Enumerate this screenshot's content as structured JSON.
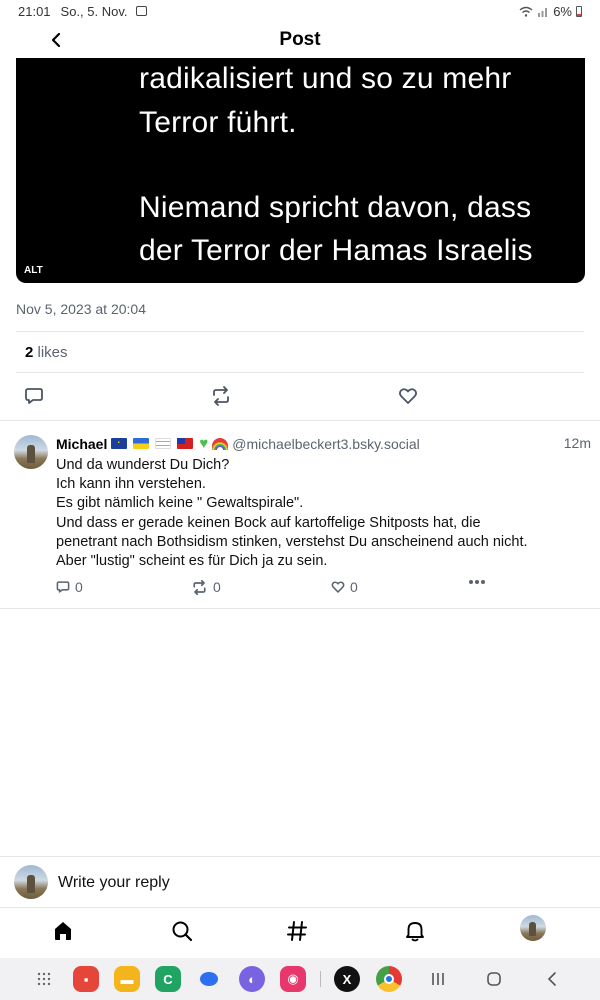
{
  "status_bar": {
    "time": "21:01",
    "date": "So., 5. Nov.",
    "battery": "6%"
  },
  "header": {
    "title": "Post"
  },
  "post": {
    "image_lines": [
      "radikalisiert und so zu mehr",
      "Terror führt.",
      "Niemand spricht davon, dass",
      "der Terror der Hamas Israelis"
    ],
    "alt_label": "ALT",
    "timestamp": "Nov 5, 2023 at 20:04",
    "likes_count": "2",
    "likes_label": "likes"
  },
  "reply": {
    "name": "Michael",
    "handle": "@michaelbeckert3.bsky.social",
    "time": "12m",
    "text_lines": [
      "Und da wunderst Du Dich?",
      "Ich kann ihn verstehen.",
      "Es gibt nämlich keine \" Gewaltspirale\".",
      "Und dass er gerade keinen Bock auf kartoffelige Shitposts hat, die",
      "penetrant nach Bothsidism stinken, verstehst Du anscheinend auch nicht.",
      "Aber \"lustig\" scheint es für Dich ja zu sein."
    ],
    "reply_count": "0",
    "repost_count": "0",
    "like_count": "0"
  },
  "composer": {
    "placeholder": "Write your reply"
  },
  "colors": {
    "muted_text": "#5b6470",
    "divider": "#e4e6e9",
    "image_bg": "#000000"
  },
  "icons": {
    "back": "chevron-left-icon",
    "reply": "speech-bubble-icon",
    "repost": "repost-arrows-icon",
    "like": "heart-icon",
    "more": "ellipsis-icon",
    "home": "home-icon",
    "search": "search-icon",
    "feeds": "hash-icon",
    "notifications": "bell-icon"
  }
}
